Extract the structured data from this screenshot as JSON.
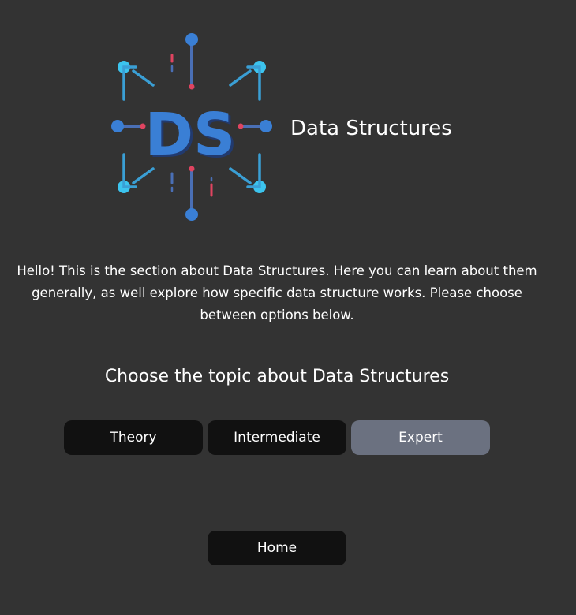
{
  "header": {
    "logo_icon": "data-structures-logo-icon",
    "logo_text": "DS",
    "title": "Data Structures"
  },
  "intro": {
    "text": "Hello! This is the section about Data Structures. Here you can learn about them generally, as well explore how specific data structure works. Please choose between options below."
  },
  "topics": {
    "heading": "Choose the topic about Data Structures",
    "buttons": [
      {
        "label": "Theory",
        "selected": false
      },
      {
        "label": "Intermediate",
        "selected": false
      },
      {
        "label": "Expert",
        "selected": true
      }
    ]
  },
  "navigation": {
    "home_label": "Home"
  },
  "colors": {
    "background": "#333333",
    "button_background": "#111111",
    "button_selected_background": "#6b7180",
    "text": "#ffffff",
    "logo_blue": "#3a7fd5",
    "logo_light_blue": "#3cc4ee",
    "logo_red": "#e04460"
  }
}
